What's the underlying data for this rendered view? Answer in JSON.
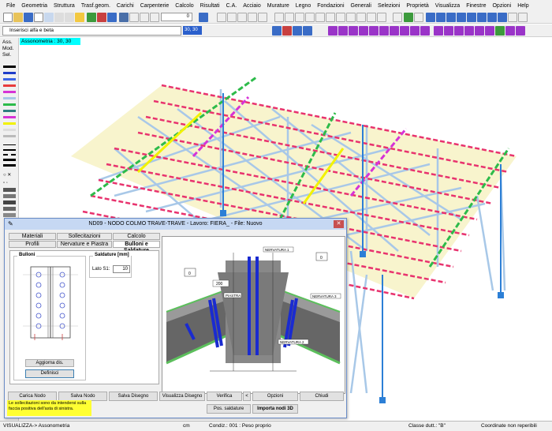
{
  "menu": [
    "File",
    "Geometria",
    "Struttura",
    "Trasf.geom.",
    "Carichi",
    "Carpenterie",
    "Calcolo",
    "Risultati",
    "C.A.",
    "Acciaio",
    "Murature",
    "Legno",
    "Fondazioni",
    "Generali",
    "Selezioni",
    "Proprietà",
    "Visualizza",
    "Finestre",
    "Opzioni",
    "Help"
  ],
  "toolbar": {
    "number_field": "0",
    "prompt": "Inserisci alfa e beta",
    "angle_value": "30, 30"
  },
  "leftbar": {
    "labels": [
      "Ass.",
      "Mod.",
      "Sel."
    ]
  },
  "view_label": "Assonometria :  30, 30",
  "dialog": {
    "title": "ND09 - NODO COLMO TRAVE-TRAVE - Lavoro: FIERA_ - File: Nuovo",
    "tabs_row1": [
      "Materiali",
      "Sollecitazioni",
      "Calcolo"
    ],
    "tabs_row2": [
      "Profili",
      "Nervature e Piastra",
      "Bulloni e Saldature"
    ],
    "bulloni_group": "Bulloni",
    "saldature_group": "Saldature [mm]",
    "lato_label": "Lato S1:",
    "lato_value": "10",
    "aggiorna_btn": "Aggiorna dis.",
    "definisci_btn": "Definisci",
    "viewport_labels": {
      "nervatura1": "NERVATURA 1",
      "nervatura2": "NERVATURA 2",
      "nervatura3": "NERVATURA 3",
      "piastra": "PIASTRA",
      "val_200": "200",
      "val_0a": "0",
      "val_0b": "0"
    },
    "buttons_row1": [
      "Carica Nodo",
      "Salva Nodo",
      "Salva Disegno",
      "Visualizza Disegno",
      "Verifica",
      "<",
      "Opzioni",
      "Chiudi"
    ],
    "buttons_row2": [
      "Pos. saldature",
      "Importa nodi 3D"
    ],
    "note": "Le sollecitazioni sono da intendersi sulla faccia positiva dell'asta di sinistra."
  },
  "status": {
    "mode": "VISUALIZZA-> Assonometria",
    "unit": "cm",
    "condition": "Condiz.: 001 : Peso proprio",
    "ductility": "Classe dutt.: \"B\"",
    "coords": "Coordinate non reperibili"
  },
  "colors": {
    "accent_cyan": "#00ffff",
    "member_pink": "#e8336e",
    "member_green": "#2dbb4a",
    "member_magenta": "#d633d6",
    "member_yellow": "#f2f200",
    "member_lightblue": "#a8c8e8",
    "column_blue": "#2c7fd6"
  }
}
